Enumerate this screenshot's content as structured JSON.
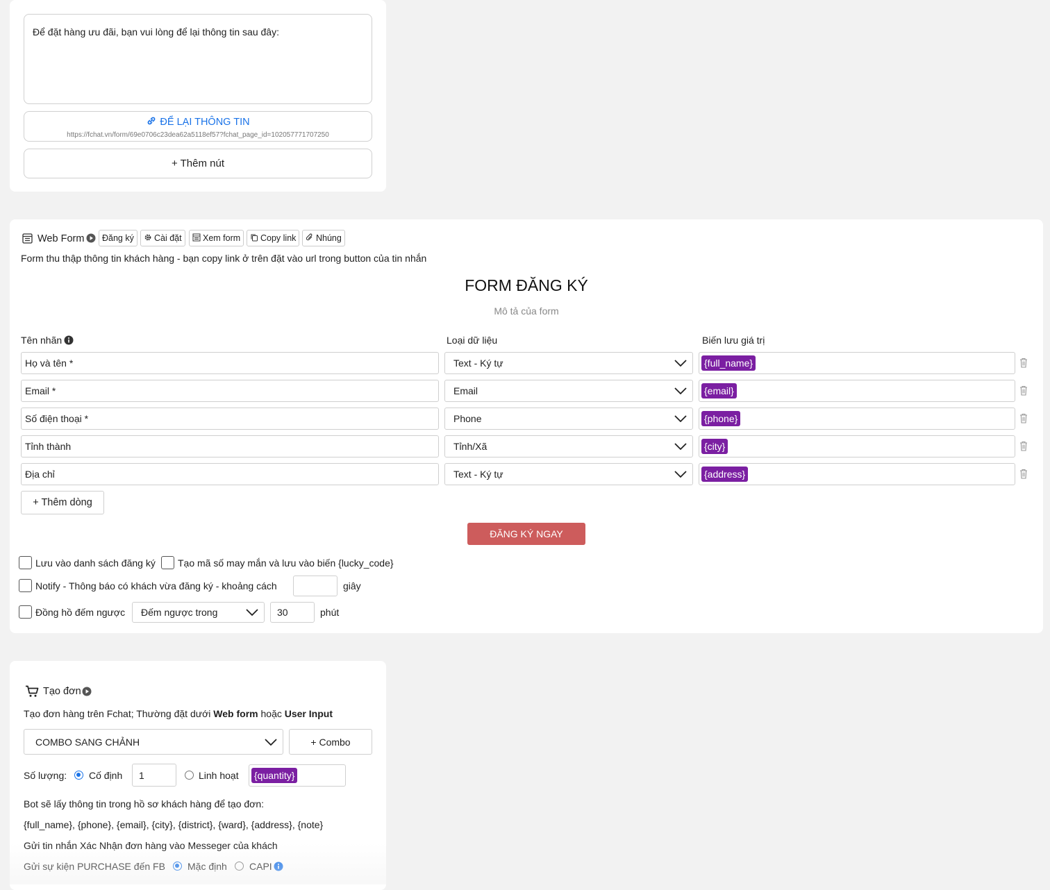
{
  "message_card": {
    "textarea_value": "Để đặt hàng ưu đãi, bạn vui lòng để lại thông tin sau đây:",
    "link_button_label": "ĐỂ LẠI THÔNG TIN",
    "link_button_url": "https://fchat.vn/form/69e0706c23dea62a5118ef57?fchat_page_id=102057771707250",
    "add_button_label": "+ Thêm nút"
  },
  "webform": {
    "title": "Web Form",
    "toolbar": {
      "register": "Đăng ký",
      "settings": "Cài đặt",
      "view_form": "Xem form",
      "copy_link": "Copy link",
      "embed": "Nhúng"
    },
    "description": "Form thu thập thông tin khách hàng - bạn copy link ở trên đặt vào url trong button của tin nhắn",
    "form_title": "FORM ĐĂNG KÝ",
    "form_subtitle": "Mô tả của form",
    "columns": {
      "label": "Tên nhãn",
      "data_type": "Loại dữ liệu",
      "variable": "Biến lưu giá trị"
    },
    "rows": [
      {
        "label": "Họ và tên *",
        "type": "Text - Ký tự",
        "variable": "{full_name}"
      },
      {
        "label": "Email *",
        "type": "Email",
        "variable": "{email}"
      },
      {
        "label": "Số điện thoại *",
        "type": "Phone",
        "variable": "{phone}"
      },
      {
        "label": "Tỉnh thành",
        "type": "Tỉnh/Xã",
        "variable": "{city}"
      },
      {
        "label": "Địa chỉ",
        "type": "Text - Ký tự",
        "variable": "{address}"
      }
    ],
    "add_row_label": "+ Thêm dòng",
    "submit_label": "ĐĂNG KÝ NGAY",
    "submit_color": "#cd5c5c",
    "options": {
      "save_list": "Lưu vào danh sách đăng ký",
      "lucky_code": "Tạo mã số may mắn và lưu vào biến {lucky_code}",
      "notify": "Notify - Thông báo có khách vừa đăng ký - khoảng cách",
      "notify_value": "",
      "notify_unit": "giây",
      "countdown": "Đồng hồ đếm ngược",
      "countdown_mode": "Đếm ngược trong",
      "countdown_value": "30",
      "countdown_unit": "phút"
    }
  },
  "order": {
    "title": "Tạo đơn",
    "desc_prefix": "Tạo đơn hàng trên Fchat; Thường đặt dưới ",
    "desc_bold1": "Web form",
    "desc_mid": " hoặc ",
    "desc_bold2": "User Input",
    "product_select": "COMBO SANG CHẢNH",
    "combo_button": "+ Combo",
    "quantity_label": "Số lượng:",
    "fixed_label": "Cố định",
    "fixed_value": "1",
    "flexible_label": "Linh hoạt",
    "flexible_variable": "{quantity}",
    "info_line1": "Bot sẽ lấy thông tin trong hồ sơ khách hàng để tạo đơn:",
    "info_line2": "{full_name}, {phone}, {email}, {city}, {district}, {ward}, {address}, {note}",
    "info_line3": "Gửi tin nhắn Xác Nhận đơn hàng vào Messeger của khách",
    "purchase_label": "Gửi sự kiện PURCHASE đến FB",
    "default_label": "Mặc định",
    "capi_label": "CAPI"
  },
  "colors": {
    "variable_tag": "#7b1fa2",
    "link_blue": "#1a73e8"
  }
}
